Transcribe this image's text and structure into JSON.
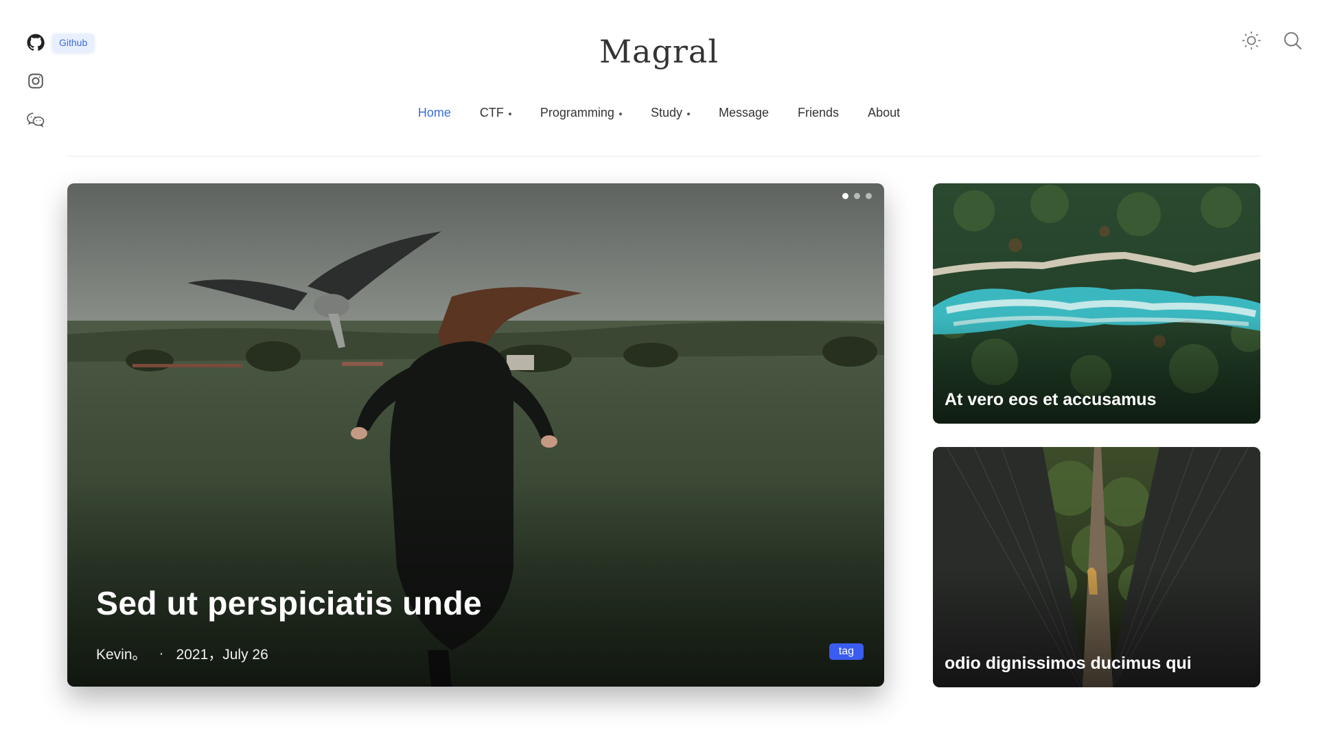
{
  "site": {
    "title": "Magral"
  },
  "social": {
    "github_tooltip": "Github",
    "icons": [
      "github-icon",
      "instagram-icon",
      "wechat-icon"
    ]
  },
  "tools": [
    "sun-icon",
    "search-icon"
  ],
  "nav": {
    "items": [
      {
        "label": "Home",
        "active": true,
        "dropdown": false
      },
      {
        "label": "CTF",
        "active": false,
        "dropdown": true
      },
      {
        "label": "Programming",
        "active": false,
        "dropdown": true
      },
      {
        "label": "Study",
        "active": false,
        "dropdown": true
      },
      {
        "label": "Message",
        "active": false,
        "dropdown": false
      },
      {
        "label": "Friends",
        "active": false,
        "dropdown": false
      },
      {
        "label": "About",
        "active": false,
        "dropdown": false
      }
    ]
  },
  "hero": {
    "title": "Sed ut perspiciatis unde",
    "author": "Kevin。",
    "separator": "·",
    "date": "2021，July 26",
    "tag": "tag",
    "slides": 3,
    "active_slide": 0
  },
  "side_cards": [
    {
      "title": "At vero eos et accusamus"
    },
    {
      "title": "odio dignissimos ducimus qui"
    }
  ],
  "colors": {
    "accent": "#3b6ce0",
    "tag": "#3b5cf0",
    "tooltip_bg": "#e8f0ff"
  }
}
